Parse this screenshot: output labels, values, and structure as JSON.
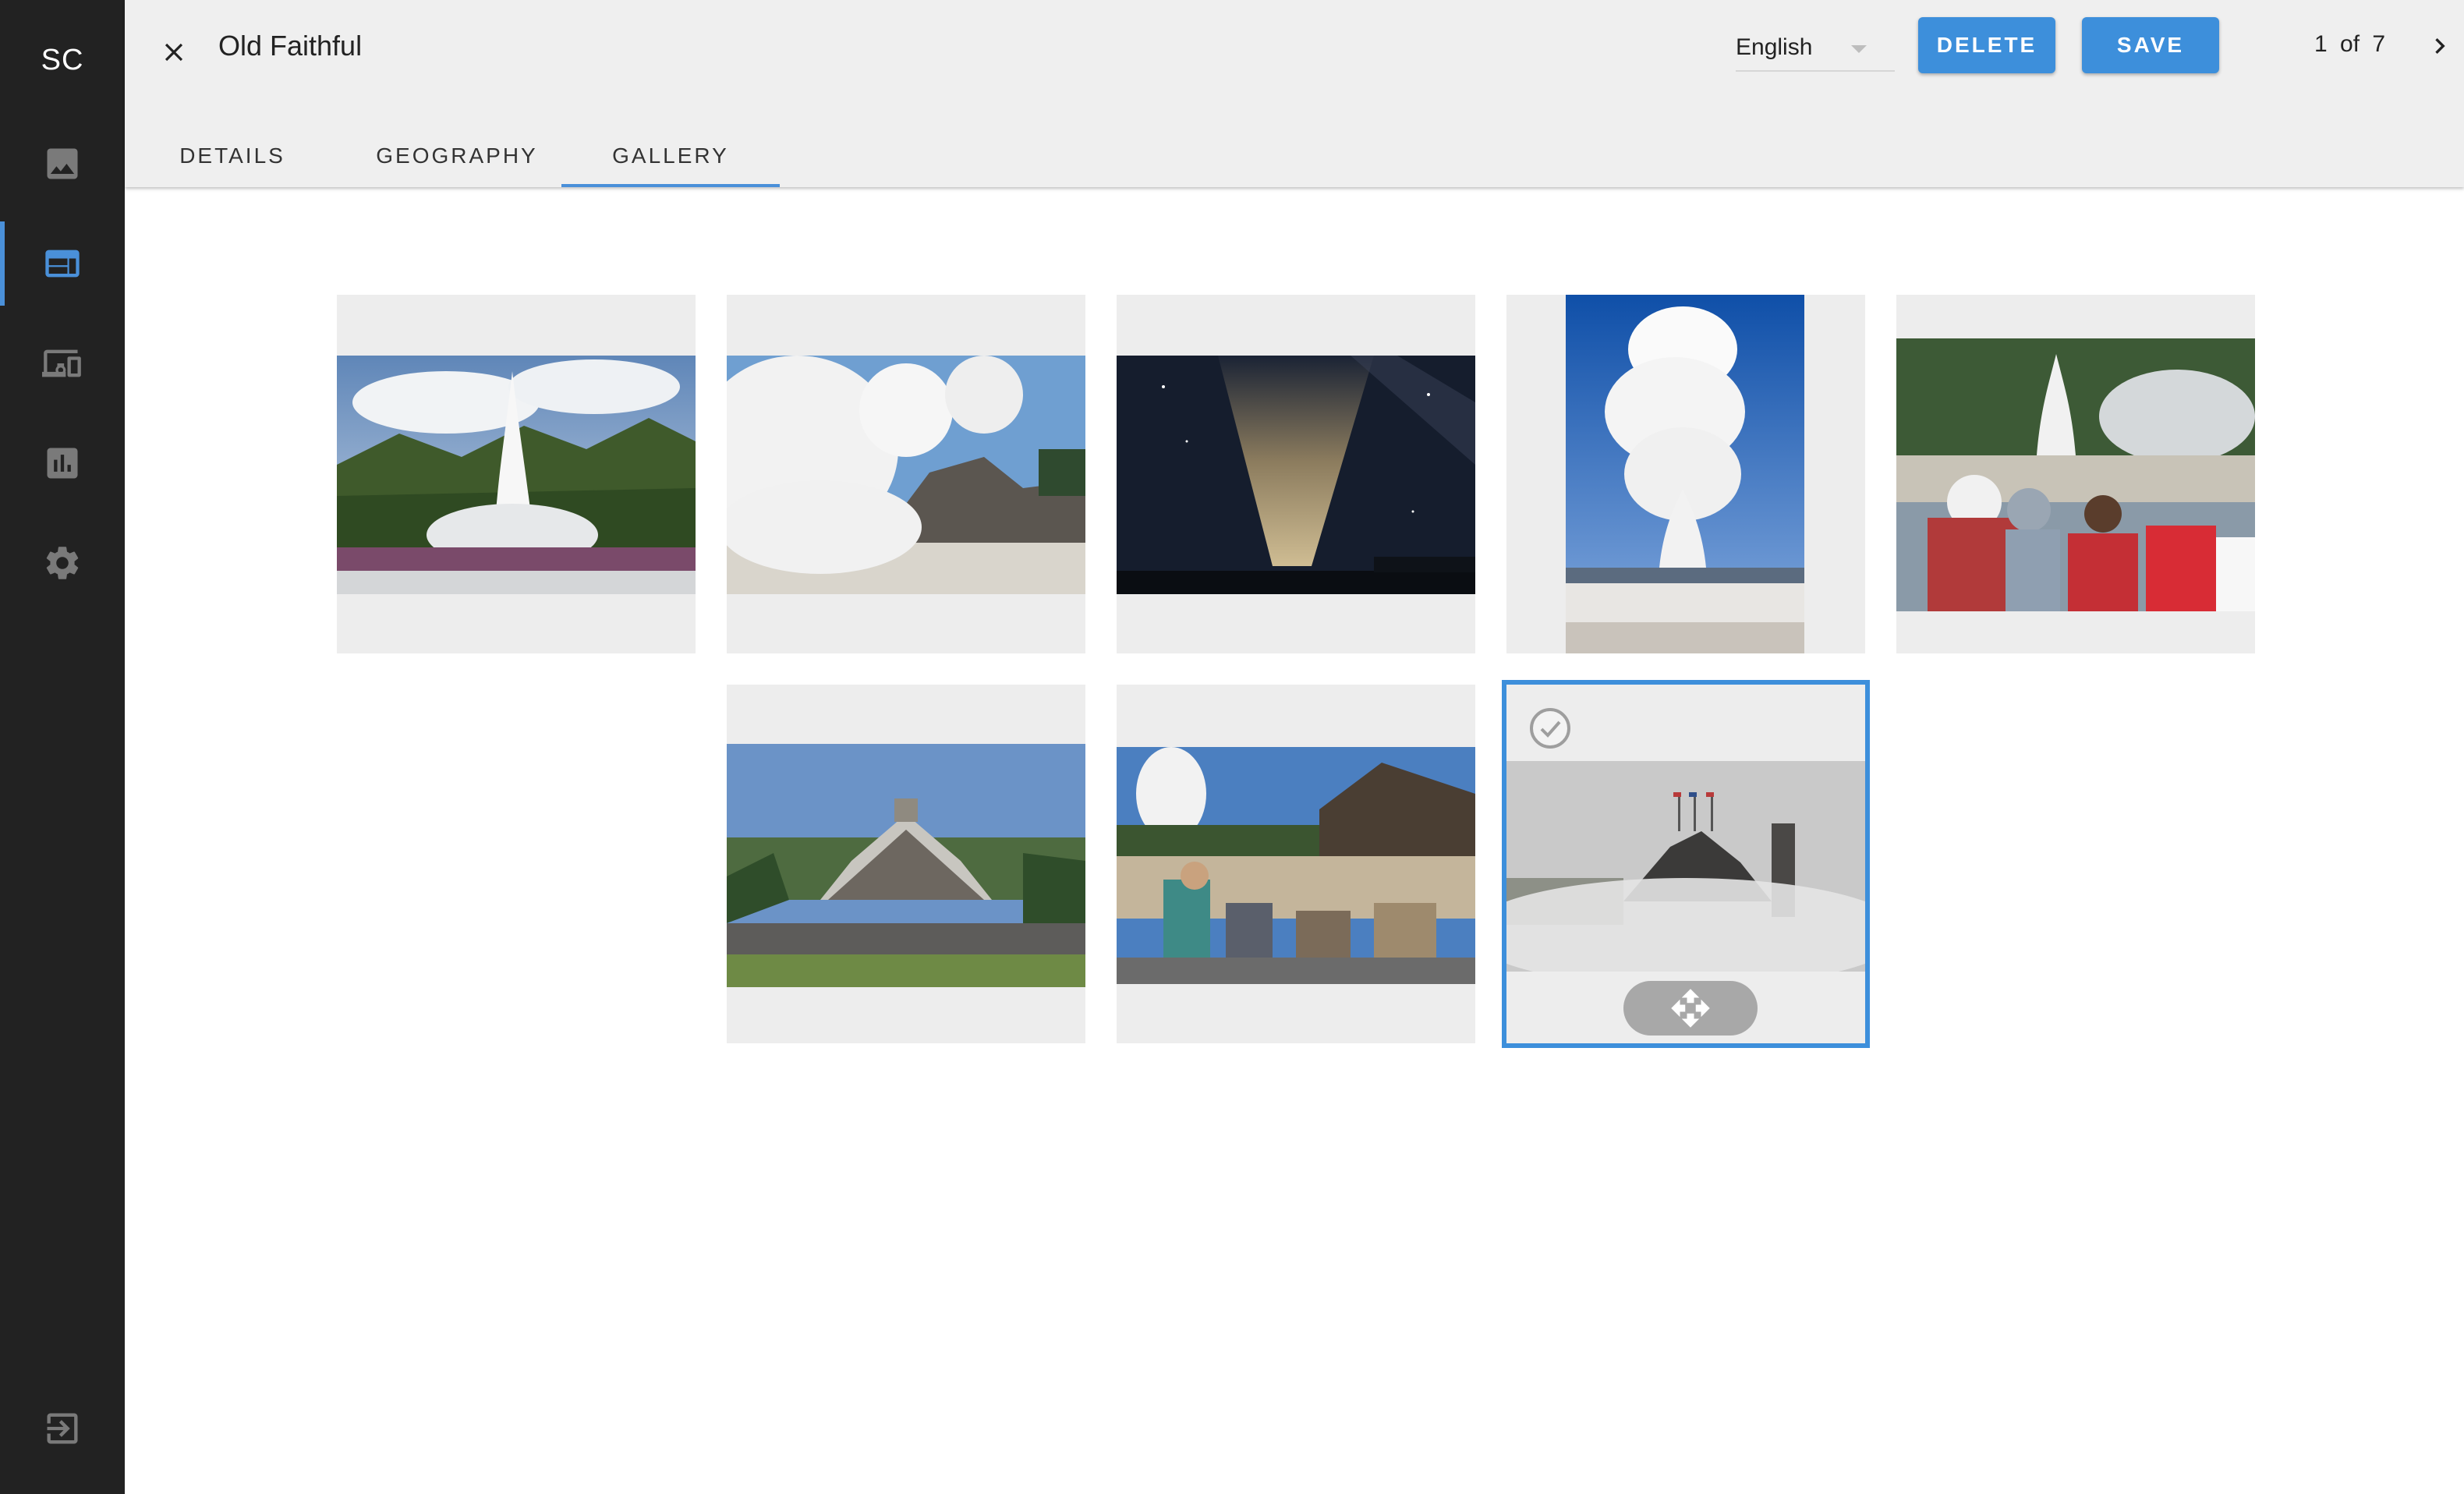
{
  "sidebar": {
    "logo": "SC",
    "items": [
      {
        "icon": "image-icon",
        "active": false
      },
      {
        "icon": "web-layout-icon",
        "active": true
      },
      {
        "icon": "devices-icon",
        "active": false
      },
      {
        "icon": "bar-chart-icon",
        "active": false
      },
      {
        "icon": "gear-icon",
        "active": false
      }
    ],
    "logout_icon": "logout-icon"
  },
  "header": {
    "title": "Old Faithful",
    "language": "English",
    "delete_label": "DELETE",
    "save_label": "SAVE",
    "pager": "1 of 7"
  },
  "tabs": [
    {
      "label": "DETAILS",
      "active": false
    },
    {
      "label": "GEOGRAPHY",
      "active": false
    },
    {
      "label": "GALLERY",
      "active": true
    }
  ],
  "gallery": {
    "photo_count": 8,
    "selected_index": 8
  },
  "colors": {
    "accent": "#3d8fdb",
    "sidebar_bg": "#222222",
    "header_bg": "#efefef",
    "tile_bg": "#ededed"
  }
}
